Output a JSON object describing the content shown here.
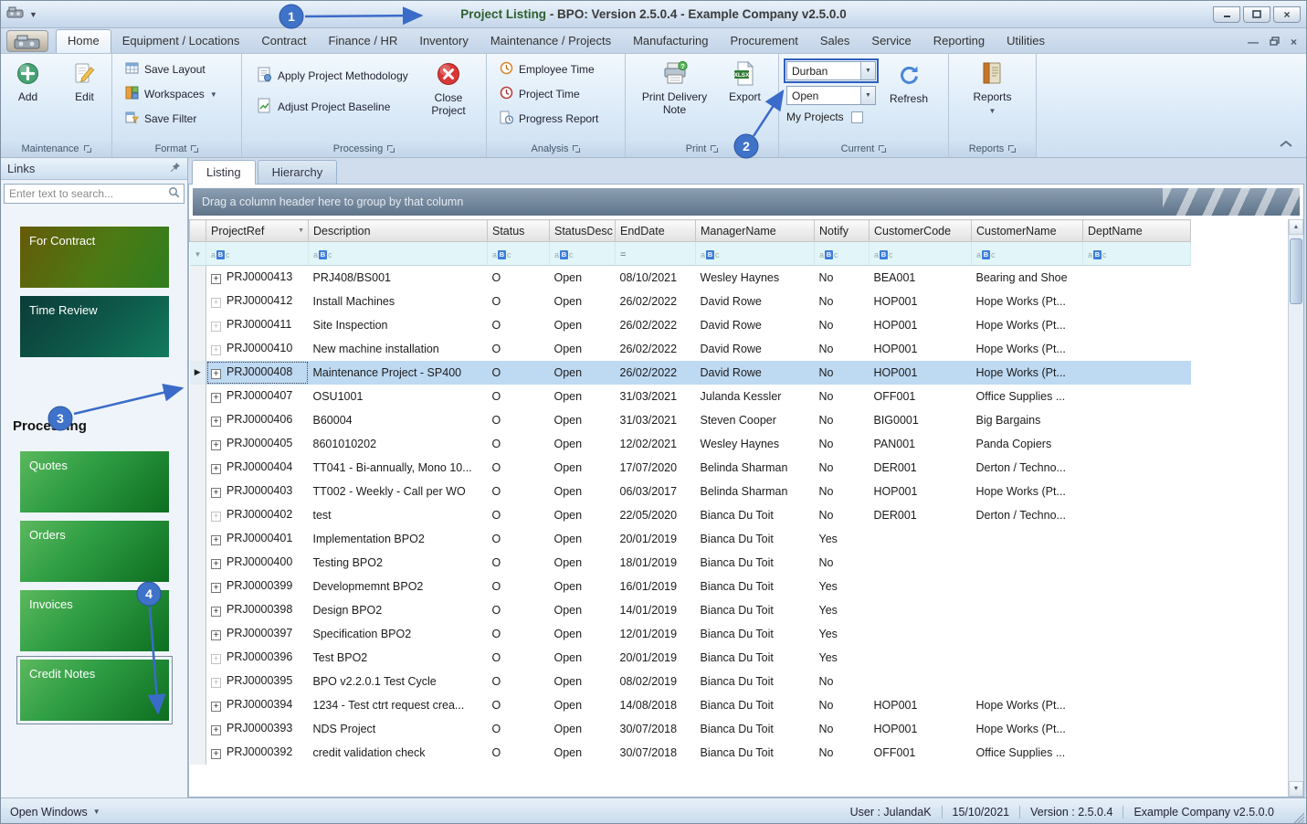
{
  "window": {
    "title_highlight": "Project Listing",
    "title_rest": " - BPO: Version 2.5.0.4 - Example Company v2.5.0.0"
  },
  "ribbon": {
    "active_tab": "Home",
    "tabs": [
      "Home",
      "Equipment / Locations",
      "Contract",
      "Finance / HR",
      "Inventory",
      "Maintenance / Projects",
      "Manufacturing",
      "Procurement",
      "Sales",
      "Service",
      "Reporting",
      "Utilities"
    ],
    "maintenance": {
      "label": "Maintenance",
      "add": "Add",
      "edit": "Edit"
    },
    "format": {
      "label": "Format",
      "save_layout": "Save Layout",
      "workspaces": "Workspaces",
      "save_filter": "Save Filter"
    },
    "processing": {
      "label": "Processing",
      "apply": "Apply Project Methodology",
      "adjust": "Adjust Project Baseline",
      "close_project": "Close Project"
    },
    "analysis": {
      "label": "Analysis",
      "employee_time": "Employee Time",
      "project_time": "Project Time",
      "progress_report": "Progress Report"
    },
    "print": {
      "label": "Print",
      "delivery_note": "Print Delivery Note",
      "export": "Export"
    },
    "current": {
      "label": "Current",
      "site": "Durban",
      "status": "Open",
      "my_projects": "My Projects",
      "refresh": "Refresh"
    },
    "reports": {
      "label": "Reports",
      "button": "Reports"
    }
  },
  "sidebar": {
    "title": "Links",
    "search_placeholder": "Enter text to search...",
    "links": [
      {
        "label": "For Contract",
        "style": "contract"
      },
      {
        "label": "Time Review",
        "style": "time"
      }
    ],
    "section": "Processing",
    "processing_links": [
      {
        "label": "Quotes"
      },
      {
        "label": "Orders"
      },
      {
        "label": "Invoices"
      },
      {
        "label": "Credit Notes",
        "selected": true
      }
    ]
  },
  "grid": {
    "tabs": [
      "Listing",
      "Hierarchy"
    ],
    "active_tab": "Listing",
    "group_hint": "Drag a column header here to group by that column",
    "columns": [
      "ProjectRef",
      "Description",
      "Status",
      "StatusDesc",
      "EndDate",
      "ManagerName",
      "Notify",
      "CustomerCode",
      "CustomerName",
      "DeptName"
    ],
    "filter_ops": [
      "abc",
      "abc",
      "abc",
      "abc",
      "eq",
      "abc",
      "abc",
      "abc",
      "abc",
      "abc"
    ],
    "rows": [
      {
        "ref": "PRJ0000413",
        "desc": "PRJ408/BS001",
        "status": "O",
        "statusDesc": "Open",
        "end": "08/10/2021",
        "manager": "Wesley Haynes",
        "notify": "No",
        "custCode": "BEA001",
        "custName": "Bearing and Shoe",
        "dept": ""
      },
      {
        "ref": "PRJ0000412",
        "desc": "Install Machines",
        "status": "O",
        "statusDesc": "Open",
        "end": "26/02/2022",
        "manager": "David Rowe",
        "notify": "No",
        "custCode": "HOP001",
        "custName": "Hope Works (Pt...",
        "dept": "",
        "dim": true
      },
      {
        "ref": "PRJ0000411",
        "desc": "Site Inspection",
        "status": "O",
        "statusDesc": "Open",
        "end": "26/02/2022",
        "manager": "David Rowe",
        "notify": "No",
        "custCode": "HOP001",
        "custName": "Hope Works (Pt...",
        "dept": "",
        "dim": true
      },
      {
        "ref": "PRJ0000410",
        "desc": "New machine installation",
        "status": "O",
        "statusDesc": "Open",
        "end": "26/02/2022",
        "manager": "David Rowe",
        "notify": "No",
        "custCode": "HOP001",
        "custName": "Hope Works (Pt...",
        "dept": "",
        "dim": true
      },
      {
        "ref": "PRJ0000408",
        "desc": "Maintenance Project - SP400",
        "status": "O",
        "statusDesc": "Open",
        "end": "26/02/2022",
        "manager": "David Rowe",
        "notify": "No",
        "custCode": "HOP001",
        "custName": "Hope Works (Pt...",
        "dept": "",
        "selected": true
      },
      {
        "ref": "PRJ0000407",
        "desc": "OSU1001",
        "status": "O",
        "statusDesc": "Open",
        "end": "31/03/2021",
        "manager": "Julanda Kessler",
        "notify": "No",
        "custCode": "OFF001",
        "custName": "Office Supplies ...",
        "dept": ""
      },
      {
        "ref": "PRJ0000406",
        "desc": "B60004",
        "status": "O",
        "statusDesc": "Open",
        "end": "31/03/2021",
        "manager": "Steven Cooper",
        "notify": "No",
        "custCode": "BIG0001",
        "custName": "Big Bargains",
        "dept": ""
      },
      {
        "ref": "PRJ0000405",
        "desc": "8601010202",
        "status": "O",
        "statusDesc": "Open",
        "end": "12/02/2021",
        "manager": "Wesley Haynes",
        "notify": "No",
        "custCode": "PAN001",
        "custName": "Panda Copiers",
        "dept": ""
      },
      {
        "ref": "PRJ0000404",
        "desc": "TT041 - Bi-annually, Mono 10...",
        "status": "O",
        "statusDesc": "Open",
        "end": "17/07/2020",
        "manager": "Belinda Sharman",
        "notify": "No",
        "custCode": "DER001",
        "custName": "Derton / Techno...",
        "dept": ""
      },
      {
        "ref": "PRJ0000403",
        "desc": "TT002 - Weekly - Call per WO",
        "status": "O",
        "statusDesc": "Open",
        "end": "06/03/2017",
        "manager": "Belinda Sharman",
        "notify": "No",
        "custCode": "HOP001",
        "custName": "Hope Works (Pt...",
        "dept": ""
      },
      {
        "ref": "PRJ0000402",
        "desc": "test",
        "status": "O",
        "statusDesc": "Open",
        "end": "22/05/2020",
        "manager": "Bianca Du Toit",
        "notify": "No",
        "custCode": "DER001",
        "custName": "Derton / Techno...",
        "dept": "",
        "dim": true
      },
      {
        "ref": "PRJ0000401",
        "desc": "Implementation BPO2",
        "status": "O",
        "statusDesc": "Open",
        "end": "20/01/2019",
        "manager": "Bianca Du Toit",
        "notify": "Yes",
        "custCode": "",
        "custName": "",
        "dept": ""
      },
      {
        "ref": "PRJ0000400",
        "desc": "Testing BPO2",
        "status": "O",
        "statusDesc": "Open",
        "end": "18/01/2019",
        "manager": "Bianca Du Toit",
        "notify": "No",
        "custCode": "",
        "custName": "",
        "dept": ""
      },
      {
        "ref": "PRJ0000399",
        "desc": "Developmemnt BPO2",
        "status": "O",
        "statusDesc": "Open",
        "end": "16/01/2019",
        "manager": "Bianca Du Toit",
        "notify": "Yes",
        "custCode": "",
        "custName": "",
        "dept": ""
      },
      {
        "ref": "PRJ0000398",
        "desc": "Design BPO2",
        "status": "O",
        "statusDesc": "Open",
        "end": "14/01/2019",
        "manager": "Bianca Du Toit",
        "notify": "Yes",
        "custCode": "",
        "custName": "",
        "dept": ""
      },
      {
        "ref": "PRJ0000397",
        "desc": "Specification BPO2",
        "status": "O",
        "statusDesc": "Open",
        "end": "12/01/2019",
        "manager": "Bianca Du Toit",
        "notify": "Yes",
        "custCode": "",
        "custName": "",
        "dept": ""
      },
      {
        "ref": "PRJ0000396",
        "desc": "Test BPO2",
        "status": "O",
        "statusDesc": "Open",
        "end": "20/01/2019",
        "manager": "Bianca Du Toit",
        "notify": "Yes",
        "custCode": "",
        "custName": "",
        "dept": "",
        "dim": true
      },
      {
        "ref": "PRJ0000395",
        "desc": "BPO v2.2.0.1 Test Cycle",
        "status": "O",
        "statusDesc": "Open",
        "end": "08/02/2019",
        "manager": "Bianca Du Toit",
        "notify": "No",
        "custCode": "",
        "custName": "",
        "dept": "",
        "dim": true
      },
      {
        "ref": "PRJ0000394",
        "desc": "1234 - Test ctrt request crea...",
        "status": "O",
        "statusDesc": "Open",
        "end": "14/08/2018",
        "manager": "Bianca Du Toit",
        "notify": "No",
        "custCode": "HOP001",
        "custName": "Hope Works (Pt...",
        "dept": ""
      },
      {
        "ref": "PRJ0000393",
        "desc": "NDS Project",
        "status": "O",
        "statusDesc": "Open",
        "end": "30/07/2018",
        "manager": "Bianca Du Toit",
        "notify": "No",
        "custCode": "HOP001",
        "custName": "Hope Works (Pt...",
        "dept": ""
      },
      {
        "ref": "PRJ0000392",
        "desc": "credit validation check",
        "status": "O",
        "statusDesc": "Open",
        "end": "30/07/2018",
        "manager": "Bianca Du Toit",
        "notify": "No",
        "custCode": "OFF001",
        "custName": "Office Supplies ...",
        "dept": ""
      }
    ]
  },
  "statusbar": {
    "open_windows": "Open Windows",
    "user": "User : JulandaK",
    "date": "15/10/2021",
    "version": "Version : 2.5.0.4",
    "company": "Example Company v2.5.0.0"
  },
  "annotations": [
    {
      "label": "1"
    },
    {
      "label": "2"
    },
    {
      "label": "3"
    },
    {
      "label": "4"
    }
  ]
}
